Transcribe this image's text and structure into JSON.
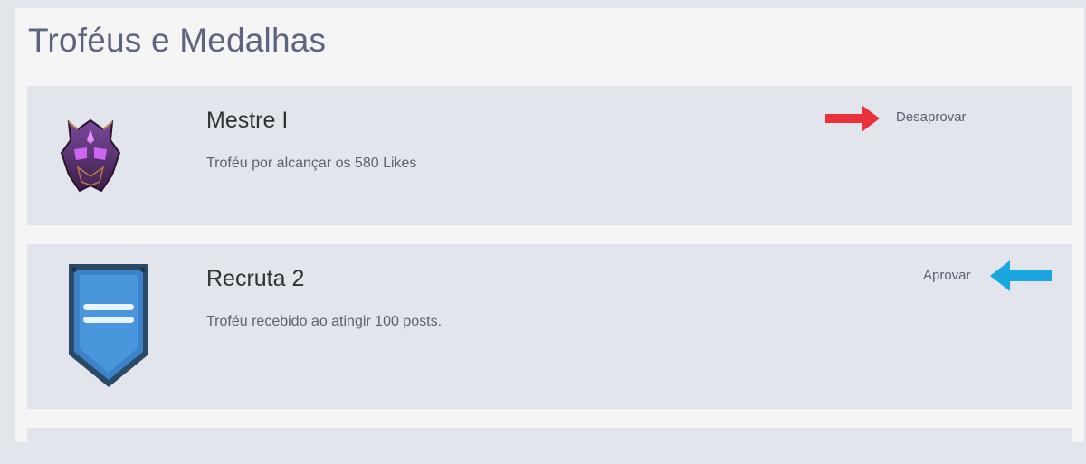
{
  "page": {
    "title": "Troféus e Medalhas"
  },
  "trophies": [
    {
      "name": "Mestre I",
      "description": "Troféu por alcançar os 580 Likes",
      "action_label": "Desaprovar",
      "icon": "purple-helmet-icon",
      "arrow_icon": "red-arrow-right-icon",
      "arrow_color": "#e8313b"
    },
    {
      "name": "Recruta 2",
      "description": "Troféu recebido ao atingir 100 posts.",
      "action_label": "Aprovar",
      "icon": "blue-shield-badge-icon",
      "arrow_icon": "blue-arrow-left-icon",
      "arrow_color": "#1aa7e0"
    }
  ],
  "colors": {
    "background": "#e3e5ec",
    "panel": "#f5f5f6",
    "title": "#5e6480"
  }
}
